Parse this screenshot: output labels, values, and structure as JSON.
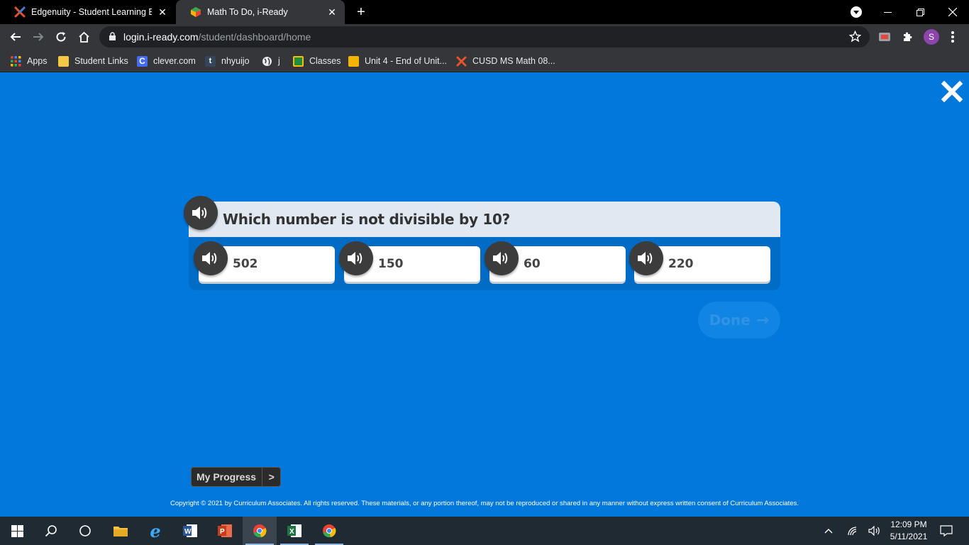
{
  "browser": {
    "tabs": [
      {
        "title": "Edgenuity - Student Learning Experience",
        "active": false
      },
      {
        "title": "Math To Do, i-Ready",
        "active": true
      }
    ],
    "url_host": "login.i-ready.com",
    "url_path": "/student/dashboard/home",
    "profile_initial": "S",
    "bookmarks": [
      {
        "label": "Apps"
      },
      {
        "label": "Student Links"
      },
      {
        "label": "clever.com"
      },
      {
        "label": "nhyuijo"
      },
      {
        "label": "j"
      },
      {
        "label": "Classes"
      },
      {
        "label": "Unit 4 - End of Unit..."
      },
      {
        "label": "CUSD MS Math 08..."
      }
    ]
  },
  "lesson": {
    "question": "Which number is not divisible by 10?",
    "answers": [
      {
        "value": "502"
      },
      {
        "value": "150"
      },
      {
        "value": "60"
      },
      {
        "value": "220"
      }
    ],
    "done_label": "Done",
    "done_arrow": "→",
    "my_progress_label": "My Progress",
    "my_progress_chevron": ">"
  },
  "footer": {
    "copyright": "Copyright © 2021 by Curriculum Associates. All rights reserved. These materials, or any portion thereof, may not be reproduced or shared in any manner without express written consent of Curriculum Associates."
  },
  "taskbar": {
    "time": "12:09 PM",
    "date": "5/11/2021"
  },
  "colors": {
    "background": "#0078dc",
    "panel": "#006cc6",
    "question_bar": "#e0e8f2",
    "speaker": "#3c3c3c",
    "done_disabled": "#1085e3"
  }
}
